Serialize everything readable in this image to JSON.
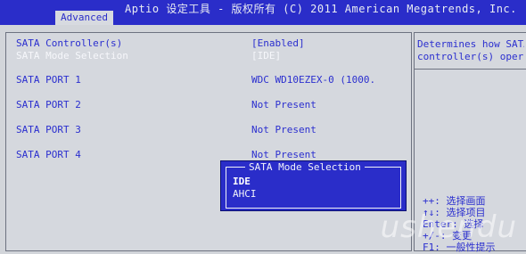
{
  "header": {
    "title": "Aptio 设定工具 - 版权所有 (C) 2011 American Megatrends, Inc.",
    "active_tab": "Advanced"
  },
  "settings": [
    {
      "label": "SATA Controller(s)",
      "value": "[Enabled]"
    },
    {
      "label": "SATA Mode Selection",
      "value": "[IDE]"
    },
    {
      "label": "SATA PORT 1",
      "value": "WDC WD10EZEX-0 (1000."
    },
    {
      "label": "SATA PORT 2",
      "value": "Not Present"
    },
    {
      "label": "SATA PORT 3",
      "value": "Not Present"
    },
    {
      "label": "SATA PORT 4",
      "value": "Not Present"
    }
  ],
  "help": {
    "text": "Determines how SATA\ncontroller(s) oper",
    "keys": "++: 选择画面\n↑↓: 选择项目\nEnter: 选择\n+/-: 变更\nF1: 一般性提示"
  },
  "popup": {
    "title": "SATA Mode Selection",
    "options": [
      "IDE",
      "AHCI"
    ],
    "selected": "IDE"
  },
  "colors": {
    "header_bar": "#2a2dc9",
    "text_blue": "#2b2fcf",
    "popup_bg": "#2a2dc9",
    "background": "#d2d5da"
  },
  "watermark": "ushendu"
}
